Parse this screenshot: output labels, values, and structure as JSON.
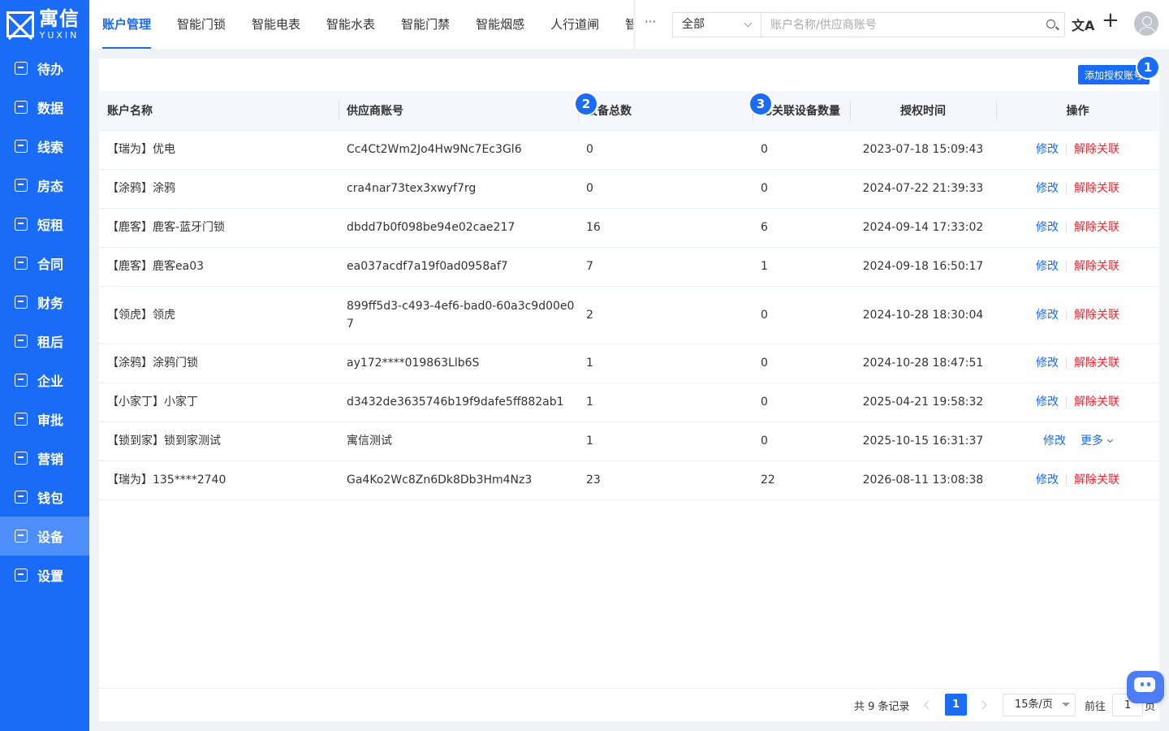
{
  "brand": {
    "name_cn": "寓信",
    "name_en": "YUXIN"
  },
  "sidebar": {
    "items": [
      {
        "label": "待办",
        "icon": "todo-icon"
      },
      {
        "label": "数据",
        "icon": "chart-icon"
      },
      {
        "label": "线索",
        "icon": "clue-icon"
      },
      {
        "label": "房态",
        "icon": "house-icon"
      },
      {
        "label": "短租",
        "icon": "calendar-icon"
      },
      {
        "label": "合同",
        "icon": "contract-icon"
      },
      {
        "label": "财务",
        "icon": "finance-icon"
      },
      {
        "label": "租后",
        "icon": "after-rent-icon"
      },
      {
        "label": "企业",
        "icon": "company-icon"
      },
      {
        "label": "审批",
        "icon": "approve-icon"
      },
      {
        "label": "营销",
        "icon": "marketing-icon"
      },
      {
        "label": "钱包",
        "icon": "wallet-icon"
      },
      {
        "label": "设备",
        "icon": "device-icon",
        "active": true
      },
      {
        "label": "设置",
        "icon": "settings-icon"
      }
    ]
  },
  "header": {
    "tabs": [
      "账户管理",
      "智能门锁",
      "智能电表",
      "智能水表",
      "智能门禁",
      "智能烟感",
      "人行道闸",
      "智"
    ],
    "more": "···",
    "filter_value": "全部",
    "search_placeholder": "账户名称/供应商账号",
    "translate_glyph": "文A",
    "plus_glyph": "+"
  },
  "toolbar": {
    "add_label": "添加授权账号",
    "badge1": "1"
  },
  "table": {
    "headers": [
      "账户名称",
      "供应商账号",
      "设备总数",
      "已关联设备数量",
      "授权时间",
      "操作"
    ],
    "badge2": "2",
    "badge3": "3",
    "rows": [
      {
        "name": "【瑞为】优电",
        "account": "Cc4Ct2Wm2Jo4Hw9Nc7Ec3Gl6",
        "total": "0",
        "linked": "0",
        "time": "2023-07-18 15:09:43",
        "edit": "修改",
        "action": "解除关联"
      },
      {
        "name": "【涂鸦】涂鸦",
        "account": "cra4nar73tex3xwyf7rg",
        "total": "0",
        "linked": "0",
        "time": "2024-07-22 21:39:33",
        "edit": "修改",
        "action": "解除关联"
      },
      {
        "name": "【鹿客】鹿客-蓝牙门锁",
        "account": "dbdd7b0f098be94e02cae217",
        "total": "16",
        "linked": "6",
        "time": "2024-09-14 17:33:02",
        "edit": "修改",
        "action": "解除关联"
      },
      {
        "name": "【鹿客】鹿客ea03",
        "account": "ea037acdf7a19f0ad0958af7",
        "total": "7",
        "linked": "1",
        "time": "2024-09-18 16:50:17",
        "edit": "修改",
        "action": "解除关联"
      },
      {
        "name": "【领虎】领虎",
        "account": "899ff5d3-c493-4ef6-bad0-60a3c9d00e07",
        "total": "2",
        "linked": "0",
        "time": "2024-10-28 18:30:04",
        "edit": "修改",
        "action": "解除关联"
      },
      {
        "name": "【涂鸦】涂鸦门锁",
        "account": "ay172****019863Llb6S",
        "total": "1",
        "linked": "0",
        "time": "2024-10-28 18:47:51",
        "edit": "修改",
        "action": "解除关联"
      },
      {
        "name": "【小家丁】小家丁",
        "account": "d3432de3635746b19f9dafe5ff882ab1",
        "total": "1",
        "linked": "0",
        "time": "2025-04-21 19:58:32",
        "edit": "修改",
        "action": "解除关联"
      },
      {
        "name": "【锁到家】锁到家测试",
        "account": "寓信测试",
        "total": "1",
        "linked": "0",
        "time": "2025-10-15 16:31:37",
        "edit": "修改",
        "action": "更多"
      },
      {
        "name": "【瑞为】135****2740",
        "account": "Ga4Ko2Wc8Zn6Dk8Db3Hm4Nz3",
        "total": "23",
        "linked": "22",
        "time": "2026-08-11 13:08:38",
        "edit": "修改",
        "action": "解除关联"
      }
    ]
  },
  "pagination": {
    "total_text": "共 9 条记录",
    "current_page": "1",
    "page_size": "15条/页",
    "goto_label": "前往",
    "goto_value": "1",
    "page_unit": "页"
  },
  "colors": {
    "primary": "#1a6cf7",
    "danger": "#f5222d"
  }
}
